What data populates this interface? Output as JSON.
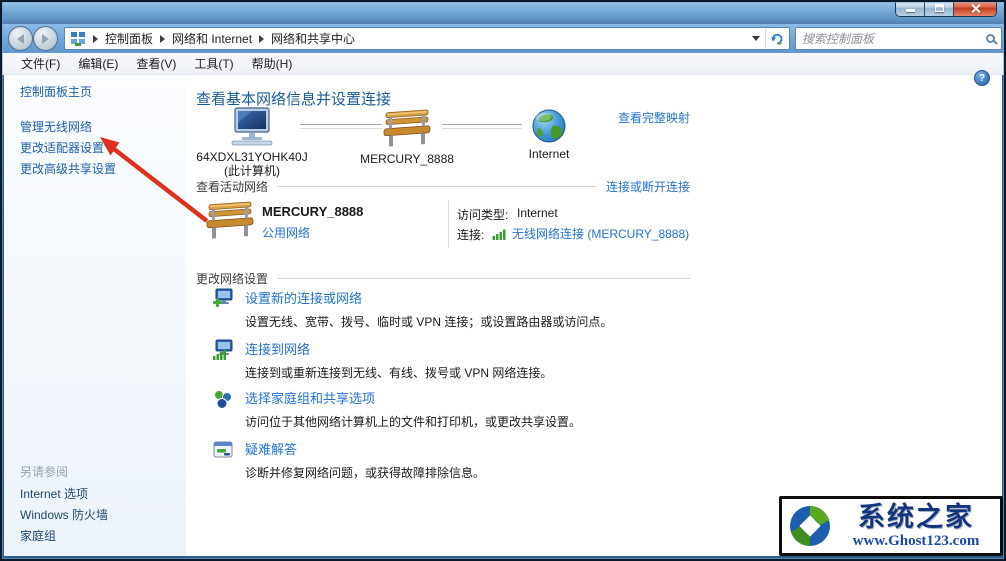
{
  "address_bar": {
    "breadcrumb": [
      "控制面板",
      "网络和 Internet",
      "网络和共享中心"
    ],
    "search_placeholder": "搜索控制面板"
  },
  "menu": {
    "items": [
      "文件(F)",
      "编辑(E)",
      "查看(V)",
      "工具(T)",
      "帮助(H)"
    ]
  },
  "sidebar": {
    "home": "控制面板主页",
    "tasks": [
      "管理无线网络",
      "更改适配器设置",
      "更改高级共享设置"
    ],
    "see_also_header": "另请参阅",
    "see_also": [
      "Internet 选项",
      "Windows 防火墙",
      "家庭组"
    ]
  },
  "main": {
    "title": "查看基本网络信息并设置连接",
    "map": {
      "computer_name": "64XDXL31YOHK40J",
      "computer_sub": "(此计算机)",
      "network_name": "MERCURY_8888",
      "internet_label": "Internet",
      "full_map_link": "查看完整映射"
    },
    "active": {
      "header": "查看活动网络",
      "connect_link": "连接或断开连接",
      "network_name": "MERCURY_8888",
      "network_type": "公用网络",
      "access_label": "访问类型:",
      "access_value": "Internet",
      "conn_label": "连接:",
      "conn_value": "无线网络连接 (MERCURY_8888)"
    },
    "settings": {
      "header": "更改网络设置",
      "items": [
        {
          "title": "设置新的连接或网络",
          "desc": "设置无线、宽带、拨号、临时或 VPN 连接；或设置路由器或访问点。"
        },
        {
          "title": "连接到网络",
          "desc": "连接到或重新连接到无线、有线、拨号或 VPN 网络连接。"
        },
        {
          "title": "选择家庭组和共享选项",
          "desc": "访问位于其他网络计算机上的文件和打印机，或更改共享设置。"
        },
        {
          "title": "疑难解答",
          "desc": "诊断并修复网络问题，或获得故障排除信息。"
        }
      ]
    }
  },
  "help_glyph": "?",
  "watermark": {
    "title": "系统之家",
    "url": "www.Ghost123.com"
  },
  "colors": {
    "link": "#2573cf",
    "page_title": "#1c5c99",
    "annotation_arrow": "#e0301e",
    "signal_green": "#35a02f",
    "close_button_red": "#c13a20"
  }
}
